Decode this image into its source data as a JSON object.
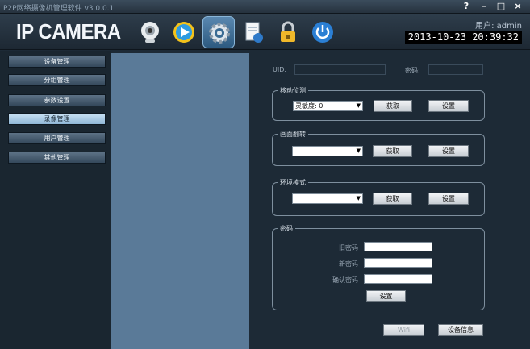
{
  "window": {
    "title": "P2P网络摄像机管理软件 v3.0.0.1",
    "help": "?",
    "minimize": "–",
    "maximize": "□",
    "close": "×"
  },
  "header": {
    "logo": "IP CAMERA",
    "user_label": "用户: admin",
    "datetime": "2013-10-23 20:39:32",
    "toolbar": [
      {
        "name": "camera-icon"
      },
      {
        "name": "playback-icon"
      },
      {
        "name": "settings-icon",
        "active": true
      },
      {
        "name": "document-icon"
      },
      {
        "name": "lock-icon"
      },
      {
        "name": "power-icon"
      }
    ]
  },
  "menu": {
    "items": [
      {
        "label": "设备管理"
      },
      {
        "label": "分组管理"
      },
      {
        "label": "参数设置"
      },
      {
        "label": "录像管理",
        "active": true
      },
      {
        "label": "用户管理"
      },
      {
        "label": "其他管理"
      }
    ]
  },
  "panel": {
    "uid_label": "UID:",
    "uid_value": "",
    "password_label": "密码:",
    "password_value": "",
    "motion": {
      "title": "移动侦测",
      "sensitivity": "灵敏度: 0",
      "get": "获取",
      "set": "设置"
    },
    "flip": {
      "title": "画面翻转",
      "value": "",
      "get": "获取",
      "set": "设置"
    },
    "env": {
      "title": "环境模式",
      "value": "",
      "get": "获取",
      "set": "设置"
    },
    "pwd": {
      "title": "密码",
      "old_label": "旧密码",
      "new_label": "新密码",
      "confirm_label": "确认密码",
      "old_value": "",
      "new_value": "",
      "confirm_value": "",
      "set": "设置"
    },
    "wifi_button": "Wifi",
    "device_info_button": "设备信息"
  }
}
